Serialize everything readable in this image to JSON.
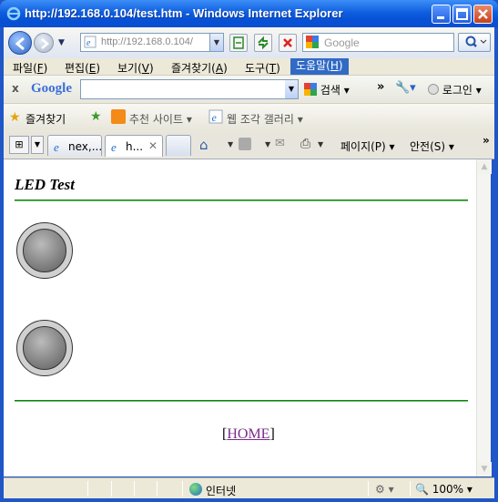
{
  "window": {
    "title": "http://192.168.0.104/test.htm - Windows Internet Explorer"
  },
  "navbar": {
    "address": "http://192.168.0.104/",
    "search_placeholder": "Google",
    "search_go_icon": "magnifier-icon"
  },
  "menu": [
    {
      "label": "파일(",
      "key": "F",
      "end": ")"
    },
    {
      "label": "편집(",
      "key": "E",
      "end": ")"
    },
    {
      "label": "보기(",
      "key": "V",
      "end": ")"
    },
    {
      "label": "즐겨찾기(",
      "key": "A",
      "end": ")"
    },
    {
      "label": "도구(",
      "key": "T",
      "end": ")"
    },
    {
      "label": "도움말(",
      "key": "H",
      "end": ")"
    }
  ],
  "google_toolbar": {
    "close": "x",
    "logo": "Google",
    "search_button": "검색",
    "more": "»",
    "login": "로그인"
  },
  "favorites_bar": {
    "favorites": "즐겨찾기",
    "suggested_sites": "추천 사이트",
    "web_slice_gallery": "웹 조각 갤러리"
  },
  "tabs": [
    {
      "label": "nex,..."
    },
    {
      "label": "h..."
    }
  ],
  "command_bar": {
    "page": "페이지(P)",
    "safety": "안전(S)",
    "chevron": "»"
  },
  "page": {
    "title": "LED Test",
    "home_link": "HOME",
    "bracket_open": "[",
    "bracket_close": "]"
  },
  "leds": [
    {
      "state": "off"
    },
    {
      "state": "off"
    }
  ],
  "status_bar": {
    "zone": "인터넷",
    "zoom": "100%"
  },
  "colors": {
    "title_bar": "#0a53d6",
    "rule": "#148014",
    "link_visited": "#7a2a8a",
    "menu_highlight": "#316ac5"
  }
}
